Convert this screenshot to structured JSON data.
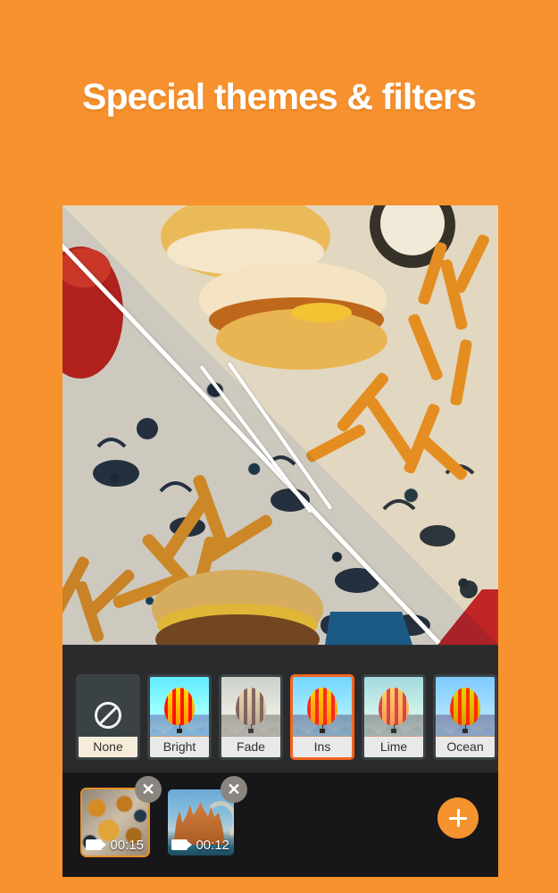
{
  "promo": {
    "headline": "Special themes & filters",
    "background_color": "#f8922e"
  },
  "accent": {
    "selected_filter_border": "#f4641e",
    "selected_clip_border": "#e8922a",
    "fab_color": "#f5932f"
  },
  "preview": {
    "name": "video-preview",
    "description": "burgers and fries on patterned wrapper paper",
    "split_comparison": true,
    "drag_arrow_icon": "swipe-arrow-icon"
  },
  "filter_strip": {
    "selected": "Ins",
    "items": [
      {
        "label": "None",
        "icon": "no-filter-icon",
        "grade": "none"
      },
      {
        "label": "Bright",
        "icon": "balloon-thumb",
        "grade": "bright"
      },
      {
        "label": "Fade",
        "icon": "balloon-thumb",
        "grade": "fade"
      },
      {
        "label": "Ins",
        "icon": "balloon-thumb",
        "grade": "ins"
      },
      {
        "label": "Lime",
        "icon": "balloon-thumb",
        "grade": "lime"
      },
      {
        "label": "Ocean",
        "icon": "balloon-thumb",
        "grade": "ocean"
      }
    ]
  },
  "timeline": {
    "clips": [
      {
        "duration": "00:15",
        "selected": true,
        "delete_icon": "close-icon",
        "media_icon": "video-camera-icon",
        "art": "paper"
      },
      {
        "duration": "00:12",
        "selected": false,
        "delete_icon": "close-icon",
        "media_icon": "video-camera-icon",
        "art": "cathedral"
      }
    ],
    "add_button": {
      "label": "+",
      "name": "add-clip-button"
    }
  }
}
